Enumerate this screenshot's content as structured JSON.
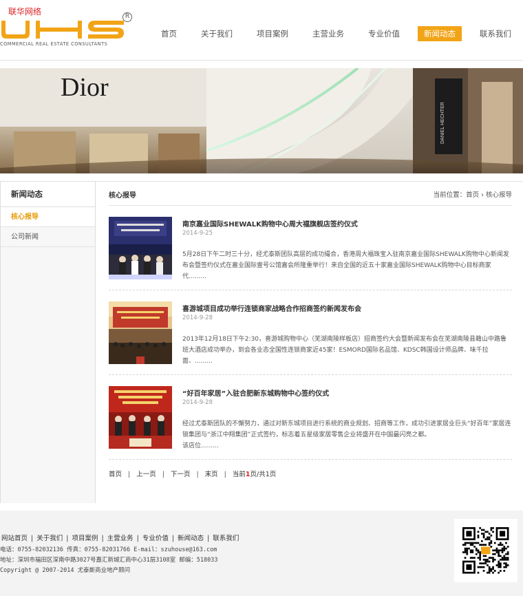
{
  "site_tag": "联华网络",
  "logo": {
    "mark_text": "UHS",
    "subtitle": "COMMERCIAL REAL ESTATE CONSULTANTS",
    "registered": "R",
    "color": "#f2a417"
  },
  "nav": {
    "items": [
      {
        "label": "首页"
      },
      {
        "label": "关于我们"
      },
      {
        "label": "项目案例"
      },
      {
        "label": "主营业务"
      },
      {
        "label": "专业价值"
      },
      {
        "label": "新闻动态",
        "active": true
      },
      {
        "label": "联系我们"
      }
    ],
    "active_color": "#f2a417"
  },
  "banner": {
    "store_sign": "Dior",
    "right_sign": "DANIEL HECHTER"
  },
  "sidebar": {
    "title": "新闻动态",
    "items": [
      {
        "label": "核心报导",
        "active": true
      },
      {
        "label": "公司新闻"
      }
    ]
  },
  "content": {
    "title": "核心报导",
    "breadcrumb": {
      "prefix": "当前位置：",
      "home": "首页",
      "separator": "›",
      "current": "核心报导"
    }
  },
  "articles": [
    {
      "title": "南京嘉业国际SHEWALK购物中心周大福旗舰店签约仪式",
      "date": "2014-9-25",
      "summary": "5月28日下午二时三十分，经尤泰斯团队高层的成功撮合，香港周大福珠宝入驻南京嘉业国际SHEWALK购物中心新闻发布会暨签约仪式在嘉业国际壹号公馆嘉会所隆重举行！来自全国的近五十家嘉业国际SHEWALK购物中心目标商家代........."
    },
    {
      "title": "喜游城项目成功举行连锁商家战略合作招商签约新闻发布会",
      "date": "2014-9-28",
      "summary": "2013年12月18日下午2:30，喜游城购物中心（芜湖南陵样板店）招商签约大会暨新闻发布会在芜湖南陵县籍山中路鲁班大酒店成功举办，到会各业态全国性连锁商家近45家！ESMORD国际名品馆、KDSC韩国设计师品牌、味千拉面、........."
    },
    {
      "title": "“好百年家居”入驻合肥新东城购物中心签约仪式",
      "date": "2014-9-28",
      "summary": "经过尤泰斯团队的不懈努力，通过对新东城项目进行系统的商业规划、招商等工作，成功引进家居业巨头“好百年”家居连锁集团与“浙江中翔集团”正式签约，标志着五星级家居零售企业将盛开在中国最闪亮之都。\n该店位........."
    }
  ],
  "pager": {
    "first": "首页",
    "prev": "上一页",
    "next": "下一页",
    "last": "末页",
    "sep": "|",
    "current_prefix": "当前",
    "current_page": "1",
    "current_suffix": "页/共1页"
  },
  "footer": {
    "links": [
      "网站首页",
      "关于我们",
      "项目案例",
      "主营业务",
      "专业价值",
      "新闻动态",
      "联系我们"
    ],
    "sep": "|",
    "contact": "电话：0755-82032136 传真：0755-82031766 E-mail：szuhouse@163.com",
    "address": "地址：深圳市福田区深南中路3027号嘉汇新城汇商中心31层3108室 邮编：518033",
    "copyright": "Copyright @ 2007-2014 尤泰斯商业地产顾问"
  }
}
